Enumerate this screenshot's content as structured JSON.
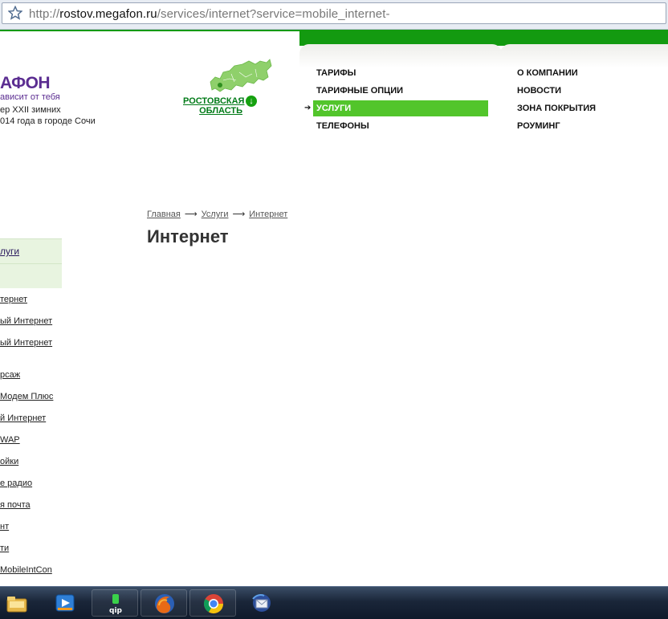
{
  "browser": {
    "url_prefix": "http://",
    "url_host": "rostov.megafon.ru",
    "url_rest": "/services/internet?service=mobile_internet-"
  },
  "header": {
    "logo_text": "АФОН",
    "slogan": "ависит от тебя",
    "olympic_line1": "ер  XXII зимних",
    "olympic_line2": "014 года в городе Сочи"
  },
  "region": {
    "line1": "РОСТОВСКАЯ",
    "line2": "ОБЛАСТЬ",
    "arrow": "↓"
  },
  "menu_left": [
    {
      "label": "ТАРИФЫ"
    },
    {
      "label": "ТАРИФНЫЕ ОПЦИИ"
    },
    {
      "label": "УСЛУГИ"
    },
    {
      "label": "ТЕЛЕФОНЫ"
    }
  ],
  "menu_right": [
    {
      "label": "О КОМПАНИИ"
    },
    {
      "label": "НОВОСТИ"
    },
    {
      "label": "ЗОНА ПОКРЫТИЯ"
    },
    {
      "label": "РОУМИНГ"
    }
  ],
  "breadcrumb": {
    "items": [
      "Главная",
      "Услуги",
      "Интернет"
    ],
    "separator": "⟶"
  },
  "page_title": "Интернет",
  "sidebar": {
    "box1_label": "луги",
    "links": [
      "тернет",
      "ый Интернет",
      "ый Интернет",
      "рсаж",
      "Модем Плюс",
      "й Интернет",
      "WAP",
      "ойки",
      "е радио",
      "я почта",
      "нт",
      "ти",
      "MobileIntCon"
    ]
  },
  "taskbar": {
    "icons": [
      "folder-icon",
      "media-player-icon",
      "qip-icon",
      "firefox-icon",
      "chrome-icon",
      "thunderbird-icon"
    ]
  },
  "colors": {
    "brand_green": "#139a10",
    "active_menu": "#52c52b",
    "logo_purple": "#5b2d91"
  }
}
